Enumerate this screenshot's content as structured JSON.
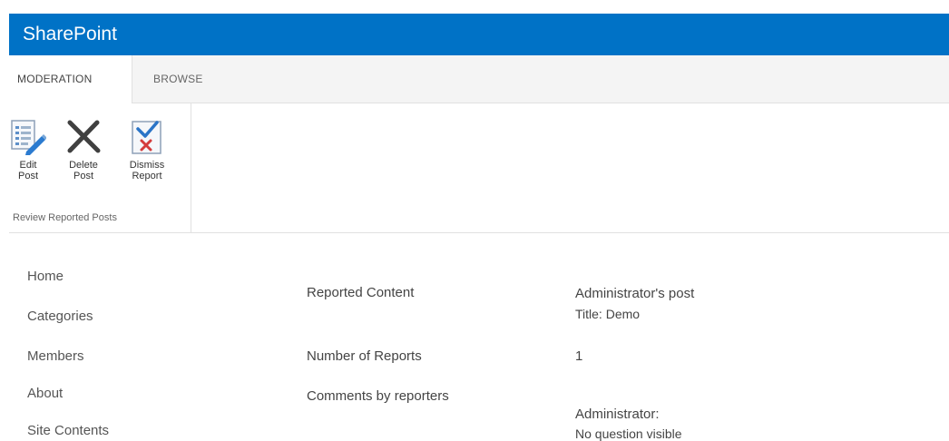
{
  "suite_bar": {
    "brand": "SharePoint"
  },
  "tabs": [
    {
      "label": "MODERATION"
    },
    {
      "label": "BROWSE"
    }
  ],
  "ribbon": {
    "buttons": [
      {
        "label": "Edit\nPost",
        "icon": "edit-post-icon"
      },
      {
        "label": "Delete\nPost",
        "icon": "delete-x-icon"
      },
      {
        "label": "Dismiss\nReport",
        "icon": "dismiss-report-icon"
      }
    ],
    "group_label": "Review Reported Posts"
  },
  "nav": {
    "items": [
      "Home",
      "Categories",
      "Members",
      "About",
      "Site Contents"
    ]
  },
  "details": {
    "reported_content_label": "Reported Content",
    "reported_content_value": "Administrator's post",
    "reported_content_title": "Title: Demo",
    "reports_label": "Number of Reports",
    "reports_value": "1",
    "comments_label": "Comments by reporters",
    "comment_author": "Administrator:",
    "comment_text": "No question visible"
  },
  "colors": {
    "suite_bar": "#0072c6",
    "tab_strip": "#f4f4f4",
    "delete_icon": "#404040",
    "dismiss_check": "#2a74c7",
    "dismiss_x": "#d43c3c"
  }
}
